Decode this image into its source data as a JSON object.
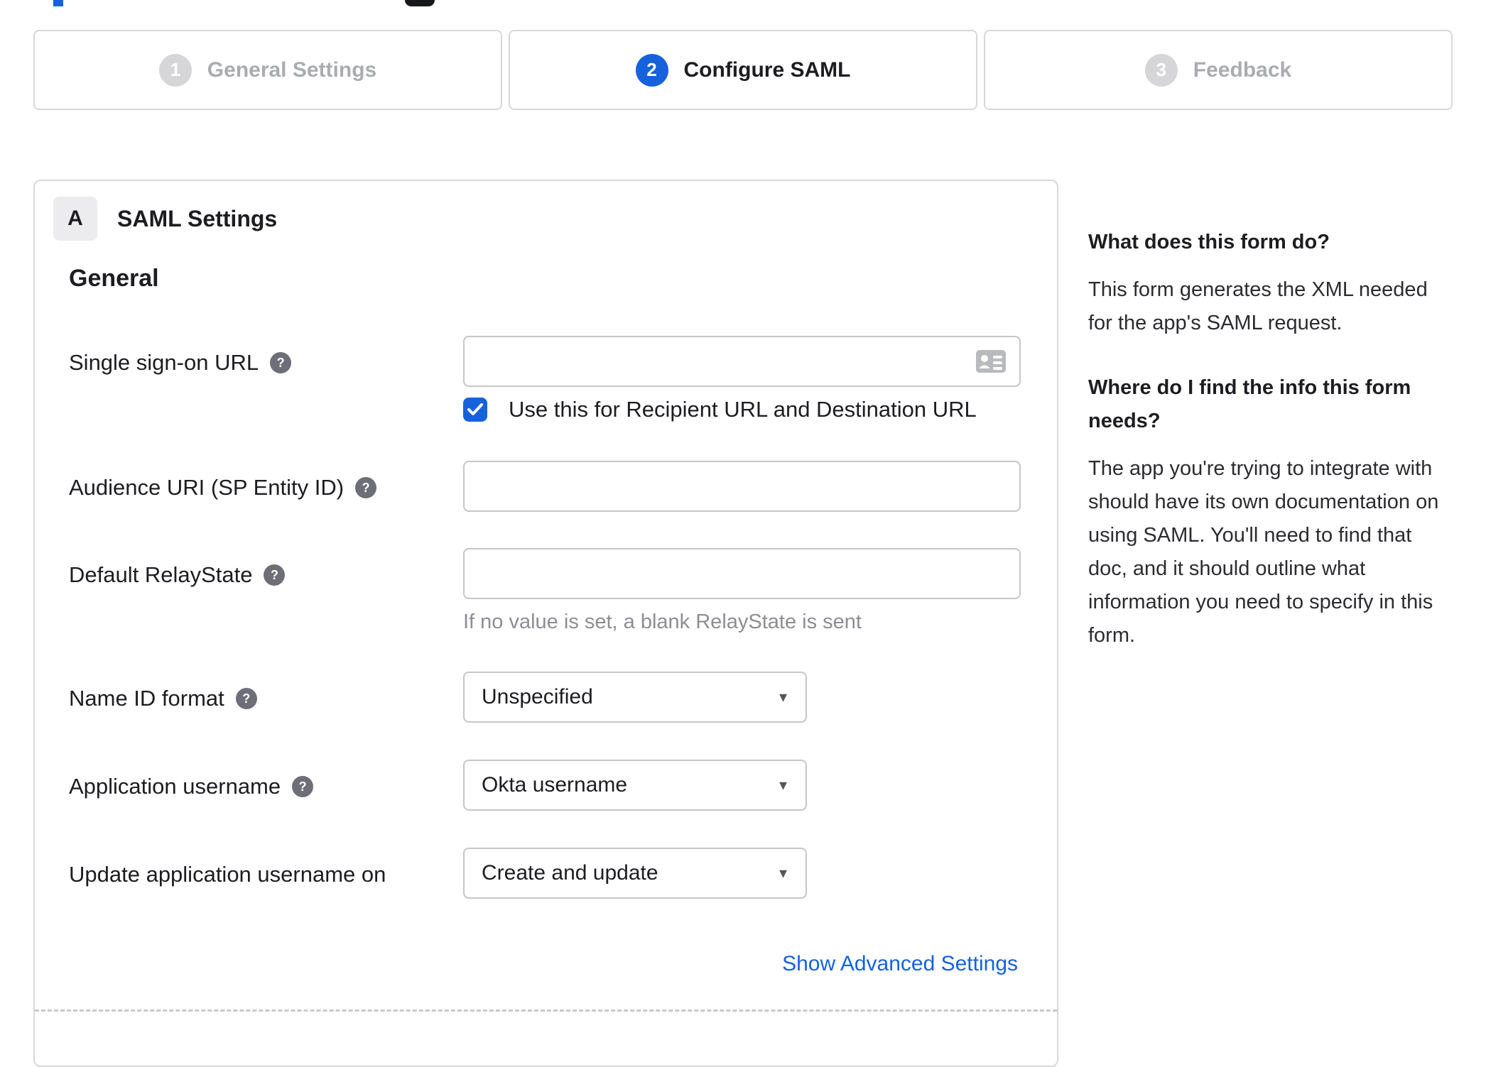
{
  "stepper": {
    "steps": [
      {
        "number": "1",
        "label": "General Settings",
        "state": "inactive"
      },
      {
        "number": "2",
        "label": "Configure SAML",
        "state": "active"
      },
      {
        "number": "3",
        "label": "Feedback",
        "state": "inactive"
      }
    ]
  },
  "panel": {
    "section_badge": "A",
    "section_title": "SAML Settings",
    "group_heading": "General",
    "fields": {
      "sso_url": {
        "label": "Single sign-on URL",
        "value": "",
        "checkbox_label": "Use this for Recipient URL and Destination URL",
        "checkbox_checked": true
      },
      "audience_uri": {
        "label": "Audience URI (SP Entity ID)",
        "value": ""
      },
      "relay_state": {
        "label": "Default RelayState",
        "value": "",
        "hint": "If no value is set, a blank RelayState is sent"
      },
      "name_id_format": {
        "label": "Name ID format",
        "value": "Unspecified"
      },
      "app_username": {
        "label": "Application username",
        "value": "Okta username"
      },
      "update_username": {
        "label": "Update application username on",
        "value": "Create and update"
      }
    },
    "advanced_link": "Show Advanced Settings"
  },
  "sidebar": {
    "sections": [
      {
        "heading": "What does this form do?",
        "body": "This form generates the XML needed for the app's SAML request."
      },
      {
        "heading": "Where do I find the info this form needs?",
        "body": "The app you're trying to integrate with should have its own documentation on using SAML. You'll need to find that doc, and it should outline what information you need to specify in this form."
      }
    ]
  },
  "icons": {
    "help_glyph": "?",
    "caret_glyph": "▾"
  },
  "colors": {
    "accent_blue": "#1662dd",
    "inactive_gray": "#aaacb0",
    "text_dark": "#1d1d21",
    "border_gray": "#d8d8da"
  }
}
